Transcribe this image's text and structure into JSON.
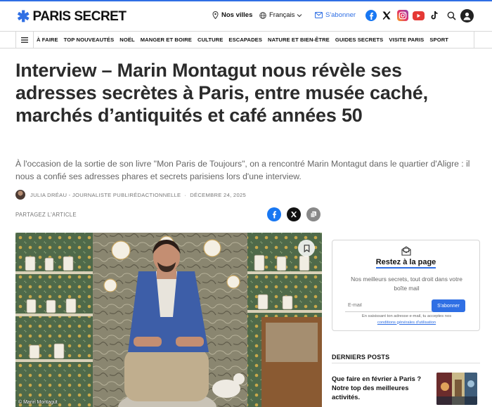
{
  "site": {
    "logo_text": "PARIS SECRET",
    "brand_color": "#2f6fe4"
  },
  "header": {
    "cities_label": "Nos villes",
    "language_label": "Français",
    "subscribe_label": "S'abonner",
    "social_icons": [
      "facebook-icon",
      "x-icon",
      "instagram-icon",
      "youtube-icon",
      "tiktok-icon"
    ]
  },
  "nav": {
    "items": [
      "À FAIRE",
      "TOP NOUVEAUTÉS",
      "NOËL",
      "MANGER ET BOIRE",
      "CULTURE",
      "ESCAPADES",
      "NATURE ET BIEN-ÊTRE",
      "GUIDES SECRETS",
      "VISITE PARIS",
      "SPORT"
    ]
  },
  "article": {
    "title": "Interview – Marin Montagut nous révèle ses adresses secrètes à Paris, entre musée caché, marchés d’antiquités et café années 50",
    "lead": "À l'occasion de la sortie de son livre \"Mon Paris de Toujours\", on a rencontré Marin Montagut dans le quartier d'Aligre : il nous a confié ses adresses phares et secrets parisiens lors d'une interview.",
    "author": "JULIA DRÉAU - JOURNALISTE PUBLIRÉDACTIONNELLE",
    "date": "DÉCEMBRE 24, 2025",
    "share_label": "PARTAGEZ L'ARTICLE",
    "photo_credit": "© Marin Montagut"
  },
  "newsletter": {
    "title": "Restez à la page",
    "description": "Nos meilleurs secrets, tout droit dans votre boîte mail",
    "email_placeholder": "E-mail",
    "button_label": "S'abonner",
    "legal_text": "En saisissant ton adresse e-mail, tu acceptes nos",
    "legal_link": "conditions générales d'utilisation"
  },
  "latest": {
    "heading": "DERNIERS POSTS",
    "posts": [
      {
        "title": "Que faire en février à Paris ? Notre top des meilleures activités."
      }
    ]
  }
}
